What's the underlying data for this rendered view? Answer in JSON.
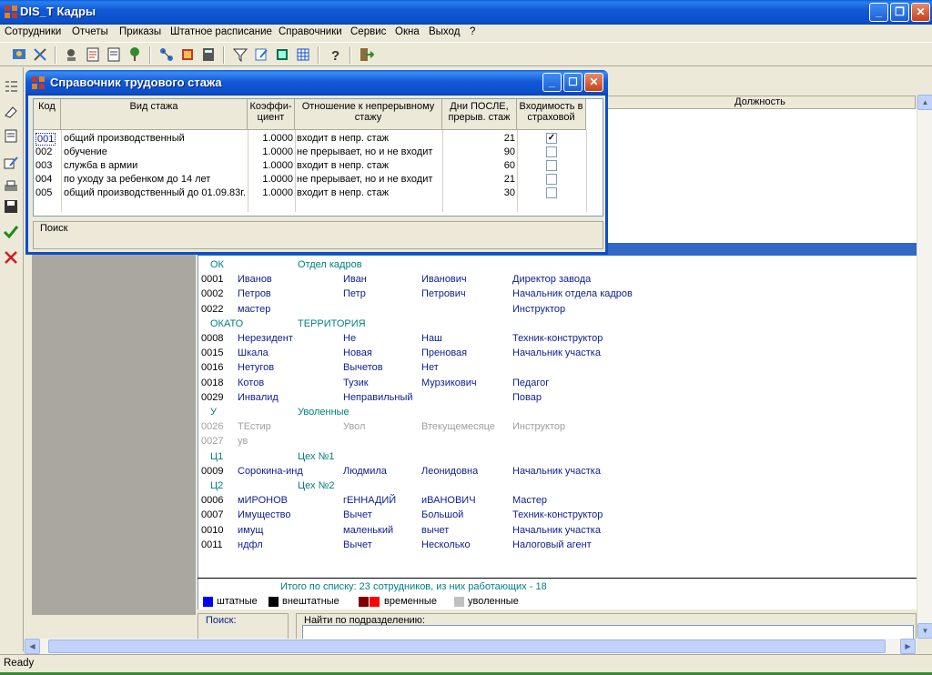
{
  "app": {
    "title": "DIS_T Кадры",
    "status": "Ready",
    "colors": {
      "titlebar": "#0b4fc9",
      "selection": "#316ac5",
      "dept": "#008080",
      "fired": "#a0a0a0"
    }
  },
  "menu": [
    "Сотрудники",
    "Отчеты",
    "Приказы",
    "Штатное расписание",
    "Справочники",
    "Сервис",
    "Окна",
    "Выход",
    "?"
  ],
  "toolbar_icons": [
    "employees-icon",
    "tools-icon",
    "user-search-icon",
    "orders-icon",
    "staff-schedule-icon",
    "palm-icon",
    "network-icon",
    "book-icon",
    "calculator-icon",
    "filter-icon",
    "edit-doc-icon",
    "spreadsheet-icon",
    "table-icon",
    "help-icon",
    "exit-icon"
  ],
  "side_icons": [
    "list-icon",
    "eraser-icon",
    "card-icon",
    "edit-icon",
    "print-icon",
    "save-icon",
    "checkmark-icon",
    "cross-icon"
  ],
  "employees": {
    "column_header": "Должность",
    "groups": [
      {
        "code": "ОК",
        "name": "Отдел кадров",
        "rows": [
          [
            "0001",
            "Иванов",
            "Иван",
            "Иванович",
            "Директор завода"
          ],
          [
            "0002",
            "Петров",
            "Петр",
            "Петрович",
            "Начальник отдела кадров"
          ],
          [
            "0022",
            "мастер",
            "",
            "",
            "Инструктор"
          ]
        ]
      },
      {
        "code": "ОКАТО",
        "name": "ТЕРРИТОРИЯ",
        "rows": [
          [
            "0008",
            "Нерезидент",
            "Не",
            "Наш",
            "Техник-конструктор"
          ],
          [
            "0015",
            "Шкала",
            "Новая",
            "Преновая",
            "Начальник участка"
          ],
          [
            "0016",
            "Нетугов",
            "Вычетов",
            "Нет",
            ""
          ],
          [
            "0018",
            "Котов",
            "Тузик",
            "Мурзикович",
            "Педагог"
          ],
          [
            "0029",
            "Инвалид",
            "Неправильный",
            "",
            "Повар"
          ]
        ]
      },
      {
        "code": "У",
        "name": "Уволенные",
        "rows": [
          [
            "0026",
            "ТЕстир",
            "Увол",
            "Втекущемесяце",
            "Инструктор"
          ],
          [
            "0027",
            "ув",
            "",
            "",
            ""
          ]
        ]
      },
      {
        "code": "Ц1",
        "name": "Цех №1",
        "rows": [
          [
            "0009",
            "Сорокина-инд",
            "Людмила",
            "Леонидовна",
            "Начальник участка"
          ]
        ]
      },
      {
        "code": "Ц2",
        "name": "Цех №2",
        "rows": [
          [
            "0006",
            "мИРОНОВ",
            "гЕННАДИЙ",
            "иВАНОВИЧ",
            "Мастер"
          ],
          [
            "0007",
            "Имущество",
            "Вычет",
            "Большой",
            "Техник-конструктор"
          ],
          [
            "0010",
            "имущ",
            "маленький",
            "вычет",
            "Начальник участка"
          ],
          [
            "0011",
            "ндфл",
            "Вычет",
            "Несколько",
            "Налоговый агент"
          ]
        ]
      }
    ],
    "total": "Итого по списку: 23 сотрудников, из них работающих - 18",
    "legend": [
      {
        "label": "штатные",
        "color": "#0000ff"
      },
      {
        "label": "внештатные",
        "color": "#000000"
      },
      {
        "label": "временные",
        "color": "#cc0000",
        "color2": "#800000"
      },
      {
        "label": "уволенные",
        "color": "#c0c0c0"
      }
    ],
    "search_label": "Поиск:",
    "find_label": "Найти по подразделению:"
  },
  "dialog": {
    "title": "Справочник трудового стажа",
    "columns": [
      "Код",
      "Вид стажа",
      "Коэффи-\nциент",
      "Отношение к непрерывному\nстажу",
      "Дни ПОСЛЕ,\nпрерыв. стаж",
      "Входимость в\nстраховой"
    ],
    "rows": [
      {
        "code": "001",
        "kind": "общий производственный",
        "coef": "1.0000",
        "relation": "входит в непр. стаж",
        "days": "21",
        "insured": true
      },
      {
        "code": "002",
        "kind": "обучение",
        "coef": "1.0000",
        "relation": "не прерывает, но и не входит",
        "days": "90",
        "insured": false
      },
      {
        "code": "003",
        "kind": "служба в армии",
        "coef": "1.0000",
        "relation": "входит в непр. стаж",
        "days": "60",
        "insured": false
      },
      {
        "code": "004",
        "kind": "по уходу за ребенком до 14 лет",
        "coef": "1.0000",
        "relation": "не прерывает, но и не входит",
        "days": "21",
        "insured": false
      },
      {
        "code": "005",
        "kind": "общий производственный до 01.09.83г.",
        "coef": "1.0000",
        "relation": "входит в непр. стаж",
        "days": "30",
        "insured": false
      }
    ],
    "search_label": "Поиск"
  }
}
